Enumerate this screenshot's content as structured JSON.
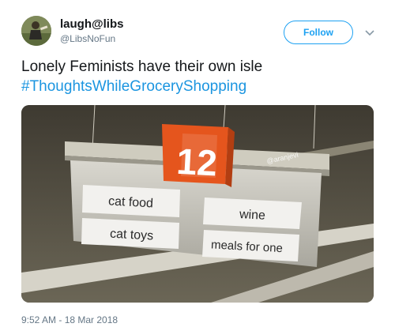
{
  "author": {
    "display_name": "laugh@libs",
    "handle": "@LibsNoFun"
  },
  "follow_button": {
    "label": "Follow",
    "color": "#1da1f2"
  },
  "menu_icon": "chevron-down-icon",
  "tweet": {
    "text": "Lonely Feminists have their own isle",
    "hashtag": "#ThoughtsWhileGroceryShopping",
    "hashtag_color": "#1b95e0"
  },
  "image": {
    "aisle_number": "12",
    "watermark": "@aranjevi",
    "signs": [
      "cat food",
      "wine",
      "cat toys",
      "meals for one"
    ]
  },
  "timestamp": "9:52 AM - 18 Mar 2018"
}
